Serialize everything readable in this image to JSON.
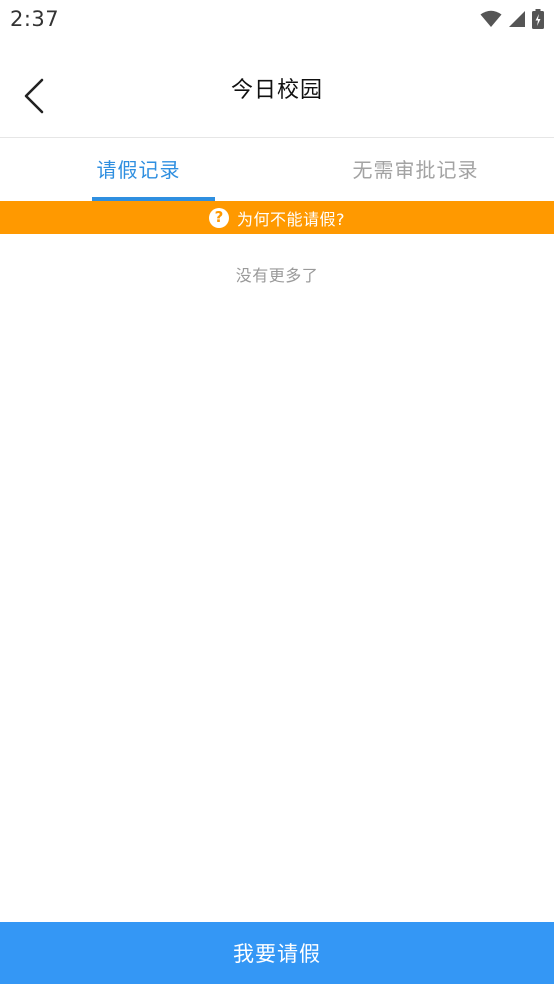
{
  "status_bar": {
    "time": "2:37",
    "icons": [
      "wifi-icon",
      "signal-icon",
      "battery-charging-icon"
    ]
  },
  "header": {
    "title": "今日校园",
    "back_icon": "chevron-left-icon"
  },
  "tabs": [
    {
      "label": "请假记录",
      "active": true
    },
    {
      "label": "无需审批记录",
      "active": false
    }
  ],
  "notice": {
    "icon": "help-circle-icon",
    "text": "为何不能请假?"
  },
  "list": {
    "empty_text": "没有更多了"
  },
  "footer": {
    "button_label": "我要请假"
  },
  "colors": {
    "accent": "#2f8fe0",
    "notice_bg": "#ff9900",
    "button_bg": "#3497f5",
    "inactive_text": "#a3a3a3"
  }
}
